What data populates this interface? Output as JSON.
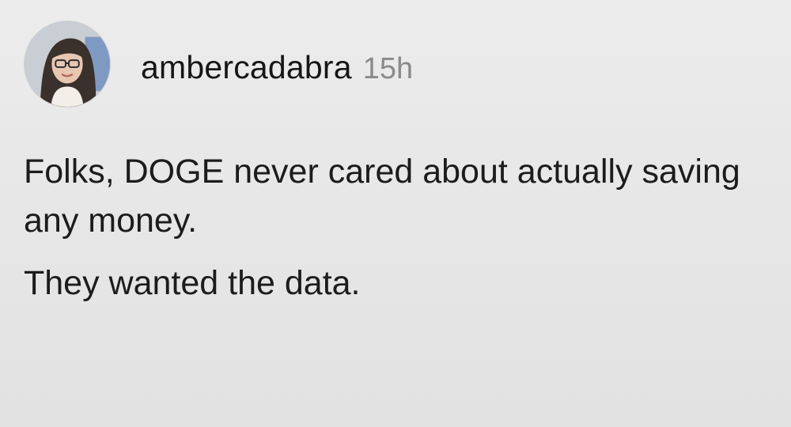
{
  "post": {
    "username": "ambercadabra",
    "timestamp": "15h",
    "avatar_icon": "profile-photo",
    "paragraphs": [
      "Folks, DOGE never cared about actually saving any money.",
      "They wanted the data."
    ]
  }
}
